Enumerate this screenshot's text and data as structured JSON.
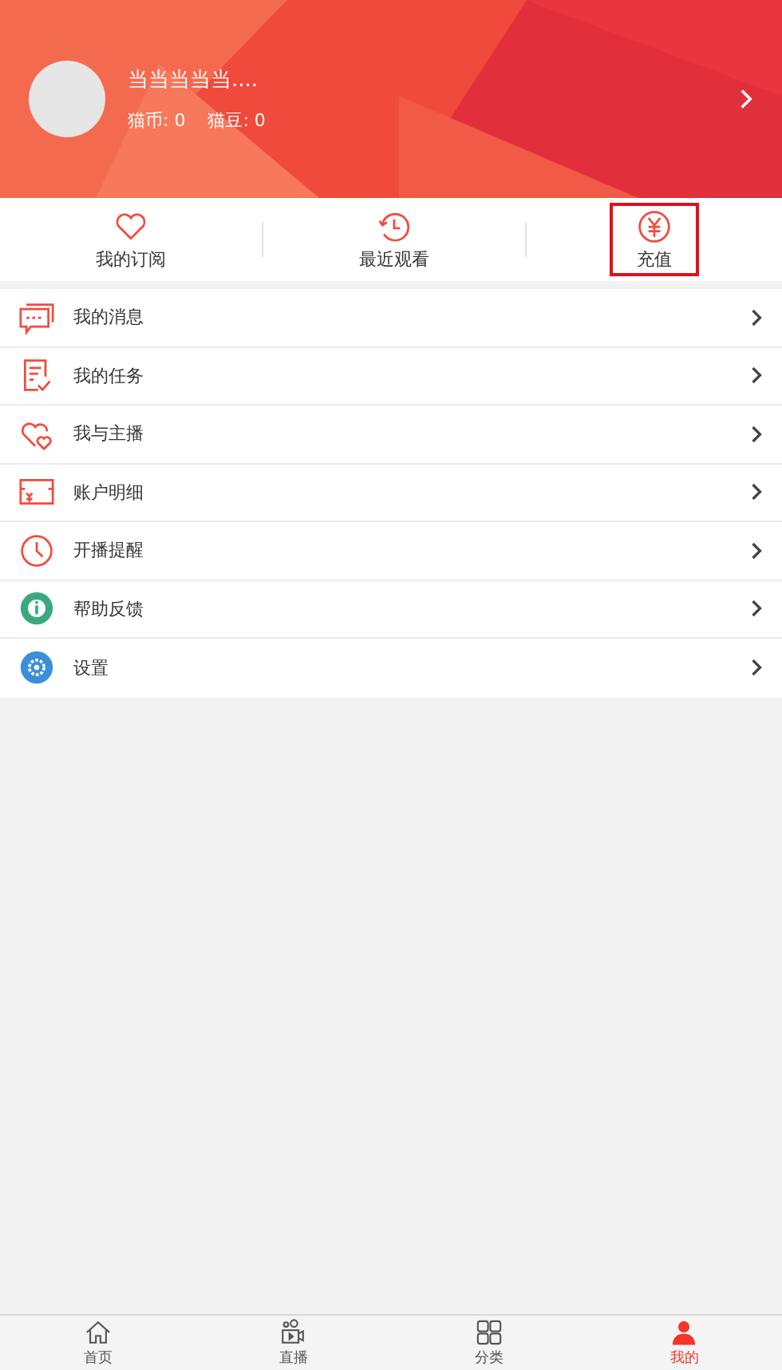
{
  "profile": {
    "name": "当当当当当....",
    "stats": [
      {
        "label": "猫币: 0"
      },
      {
        "label": "猫豆: 0"
      }
    ]
  },
  "quick_actions": [
    {
      "kind": "heart",
      "label": "我的订阅",
      "highlighted": false
    },
    {
      "kind": "history",
      "label": "最近观看",
      "highlighted": false
    },
    {
      "kind": "yen",
      "label": "充值",
      "highlighted": true
    }
  ],
  "menu": [
    {
      "kind": "message",
      "label": "我的消息"
    },
    {
      "kind": "task",
      "label": "我的任务"
    },
    {
      "kind": "hearts",
      "label": "我与主播"
    },
    {
      "kind": "account",
      "label": "账户明细"
    },
    {
      "kind": "clock",
      "label": "开播提醒"
    },
    {
      "kind": "info",
      "label": "帮助反馈"
    },
    {
      "kind": "gear",
      "label": "设置"
    }
  ],
  "tab_bar": [
    {
      "kind": "home",
      "label": "首页",
      "selected": false
    },
    {
      "kind": "live",
      "label": "直播",
      "selected": false
    },
    {
      "kind": "grid",
      "label": "分类",
      "selected": false
    },
    {
      "kind": "person",
      "label": "我的",
      "selected": true
    }
  ]
}
